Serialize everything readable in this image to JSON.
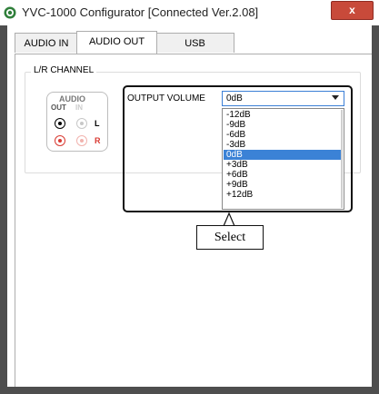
{
  "window": {
    "title": "YVC-1000 Configurator   [Connected  Ver.2.08]",
    "close_label": "x"
  },
  "tabs": [
    {
      "label": "AUDIO IN",
      "active": false
    },
    {
      "label": "AUDIO OUT",
      "active": true
    },
    {
      "label": "USB",
      "active": false
    }
  ],
  "channel_group": {
    "legend": "L/R CHANNEL",
    "audio_title": "AUDIO",
    "out_label": "OUT",
    "in_label": "IN",
    "left_label": "L",
    "right_label": "R",
    "colors": {
      "left": "#000000",
      "right": "#d93a32",
      "inactive_left": "#c8c8c8",
      "inactive_right": "#f1b3ae"
    }
  },
  "output_volume": {
    "label": "OUTPUT VOLUME",
    "selected": "0dB",
    "options": [
      "-12dB",
      "-9dB",
      "-6dB",
      "-3dB",
      "0dB",
      "+3dB",
      "+6dB",
      "+9dB",
      "+12dB"
    ],
    "highlight_color": "#3b82d6"
  },
  "callout": {
    "label": "Select"
  }
}
